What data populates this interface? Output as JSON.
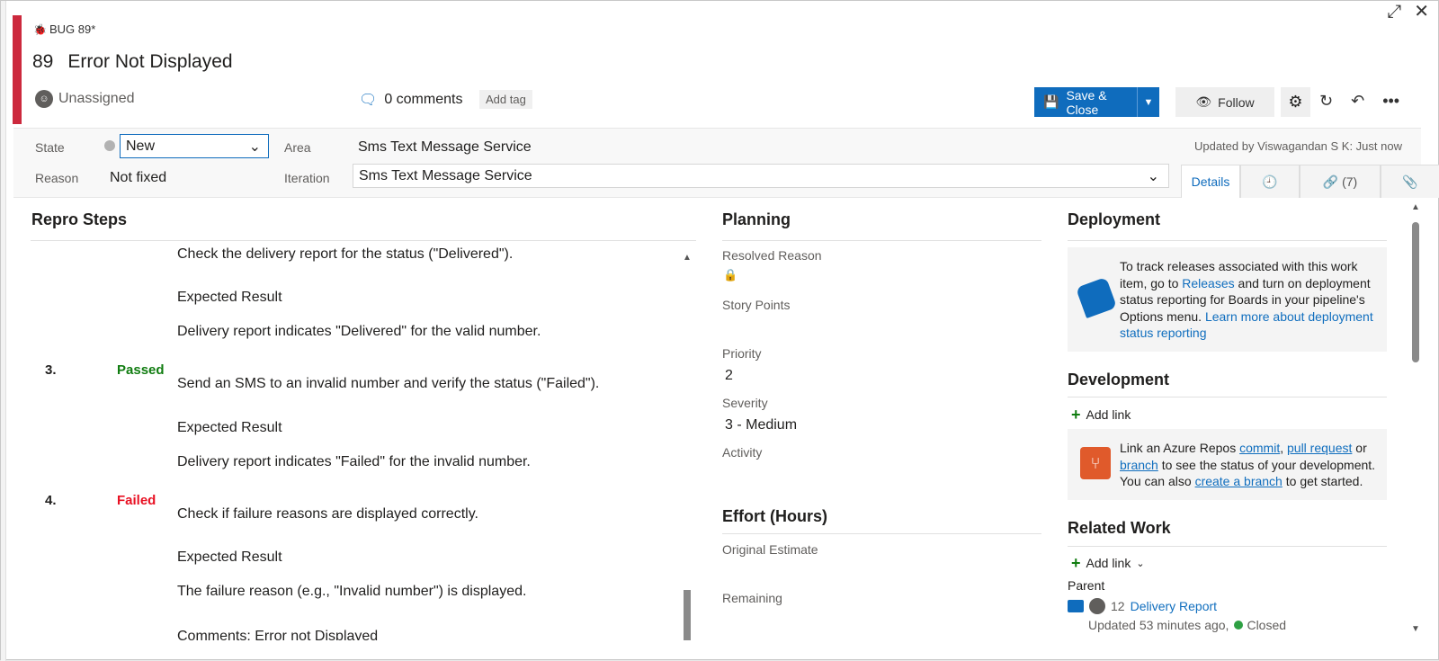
{
  "window": {
    "expand_icon": "expand-icon",
    "close_icon": "close-icon"
  },
  "header": {
    "type_label": "BUG 89*",
    "id": "89",
    "title": "Error Not Displayed",
    "assignee": "Unassigned",
    "comments": "0 comments",
    "add_tag": "Add tag",
    "save_label": "Save & Close",
    "follow_label": "Follow"
  },
  "meta": {
    "state_label": "State",
    "state_value": "New",
    "reason_label": "Reason",
    "reason_value": "Not fixed",
    "area_label": "Area",
    "area_value": "Sms Text Message Service",
    "iteration_label": "Iteration",
    "iteration_value": "Sms Text Message Service",
    "updated": "Updated by Viswagandan S K: Just now"
  },
  "tabs": {
    "details": "Details",
    "links": "(7)"
  },
  "repro": {
    "title": "Repro Steps",
    "line1": "Check the delivery report for the status (\"Delivered\").",
    "expected1": "Expected Result",
    "result1": "Delivery report indicates \"Delivered\" for the valid number.",
    "step3_num": "3.",
    "step3_status": "Passed",
    "step3_action": "Send an SMS to an invalid number and verify the status (\"Failed\").",
    "expected3": "Expected Result",
    "result3": "Delivery report indicates \"Failed\" for the invalid number.",
    "step4_num": "4.",
    "step4_status": "Failed",
    "step4_action": "Check if failure reasons are displayed correctly.",
    "expected4": "Expected Result",
    "result4": "The failure reason (e.g., \"Invalid number\") is displayed.",
    "comments_line": "Comments: Error not Displayed"
  },
  "planning": {
    "title": "Planning",
    "resolved_reason": "Resolved Reason",
    "story_points": "Story Points",
    "priority_label": "Priority",
    "priority_value": "2",
    "severity_label": "Severity",
    "severity_value": "3 - Medium",
    "activity_label": "Activity"
  },
  "effort": {
    "title": "Effort (Hours)",
    "original_estimate": "Original Estimate",
    "remaining": "Remaining"
  },
  "deployment": {
    "title": "Deployment",
    "text_a": "To track releases associated with this work item, go to ",
    "releases_link": "Releases",
    "text_b": " and turn on deployment status reporting for Boards in your pipeline's Options menu. ",
    "learn_link": "Learn more about deployment status reporting"
  },
  "development": {
    "title": "Development",
    "add_link": "Add link",
    "text_a": "Link an Azure Repos ",
    "commit_link": "commit",
    "sep1": ", ",
    "pr_link": "pull request",
    "text_b": " or ",
    "branch_link": "branch",
    "text_c": " to see the status of your development. You can also ",
    "create_branch_link": "create a branch",
    "text_d": " to get started."
  },
  "related": {
    "title": "Related Work",
    "add_link": "Add link",
    "parent_label": "Parent",
    "parent_id": "12",
    "parent_title": "Delivery Report",
    "parent_updated": "Updated 53 minutes ago,",
    "parent_state": "Closed"
  }
}
